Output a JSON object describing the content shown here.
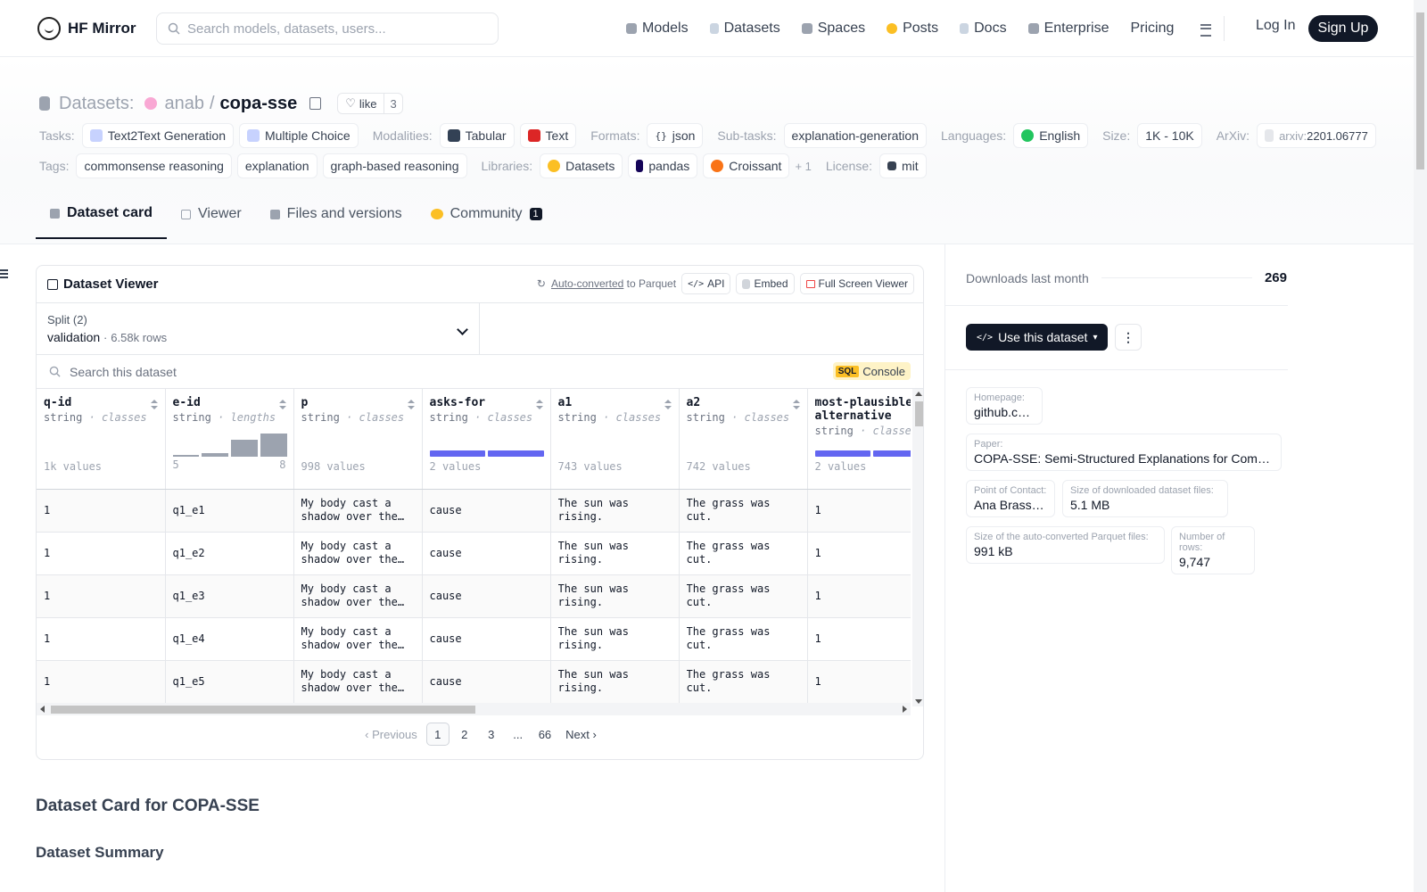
{
  "nav": {
    "brand": "HF Mirror",
    "search_placeholder": "Search models, datasets, users...",
    "links": [
      "Models",
      "Datasets",
      "Spaces",
      "Posts",
      "Docs",
      "Enterprise",
      "Pricing"
    ],
    "login": "Log In",
    "signup": "Sign Up"
  },
  "repo": {
    "section": "Datasets:",
    "owner": "anab",
    "sep": "/",
    "name": "copa-sse",
    "like_label": "like",
    "like_count": "3"
  },
  "tags": {
    "tasks_label": "Tasks:",
    "tasks": [
      "Text2Text Generation",
      "Multiple Choice"
    ],
    "modalities_label": "Modalities:",
    "modalities": [
      "Tabular",
      "Text"
    ],
    "formats_label": "Formats:",
    "formats": [
      "json"
    ],
    "subtasks_label": "Sub-tasks:",
    "subtasks": [
      "explanation-generation"
    ],
    "languages_label": "Languages:",
    "languages": [
      "English"
    ],
    "size_label": "Size:",
    "size": "1K - 10K",
    "arxiv_label": "ArXiv:",
    "arxiv_prefix": "arxiv:",
    "arxiv_id": "2201.06777",
    "tags_label": "Tags:",
    "tags": [
      "commonsense reasoning",
      "explanation",
      "graph-based reasoning"
    ],
    "libraries_label": "Libraries:",
    "libraries": [
      "Datasets",
      "pandas",
      "Croissant"
    ],
    "libraries_more": "+ 1",
    "license_label": "License:",
    "license": "mit"
  },
  "tabs": [
    {
      "label": "Dataset card"
    },
    {
      "label": "Viewer"
    },
    {
      "label": "Files and versions"
    },
    {
      "label": "Community",
      "badge": "1"
    }
  ],
  "viewer": {
    "title": "Dataset Viewer",
    "autoconv": "Auto-converted",
    "autoconv_tail": " to Parquet",
    "api": "API",
    "embed": "Embed",
    "fullscreen": "Full Screen Viewer",
    "split_label": "Split (2)",
    "split_value": "validation",
    "split_dot": "·",
    "split_rows": "6.58k rows",
    "search_placeholder": "Search this dataset",
    "sql_tag": "SQL",
    "sql_label": "Console",
    "columns": [
      {
        "name": "q-id",
        "type": "string",
        "kind": "classes",
        "values": "1k values"
      },
      {
        "name": "e-id",
        "type": "string",
        "kind": "lengths",
        "hist_min": "5",
        "hist_max": "8",
        "hist": [
          0.05,
          0.15,
          0.7,
          1.0
        ]
      },
      {
        "name": "p",
        "type": "string",
        "kind": "classes",
        "values": "998 values"
      },
      {
        "name": "asks-for",
        "type": "string",
        "kind": "classes",
        "values": "2 values"
      },
      {
        "name": "a1",
        "type": "string",
        "kind": "classes",
        "values": "743 values"
      },
      {
        "name": "a2",
        "type": "string",
        "kind": "classes",
        "values": "742 values"
      },
      {
        "name": "most-plausible-alternative",
        "type": "string",
        "kind": "classes",
        "values": "2 values"
      }
    ],
    "type_sep": " · ",
    "rows": [
      [
        "1",
        "q1_e1",
        "My body cast a shadow over the grass.",
        "cause",
        "The sun was rising.",
        "The grass was cut.",
        "1"
      ],
      [
        "1",
        "q1_e2",
        "My body cast a shadow over the grass.",
        "cause",
        "The sun was rising.",
        "The grass was cut.",
        "1"
      ],
      [
        "1",
        "q1_e3",
        "My body cast a shadow over the grass.",
        "cause",
        "The sun was rising.",
        "The grass was cut.",
        "1"
      ],
      [
        "1",
        "q1_e4",
        "My body cast a shadow over the grass.",
        "cause",
        "The sun was rising.",
        "The grass was cut.",
        "1"
      ],
      [
        "1",
        "q1_e5",
        "My body cast a shadow over the grass.",
        "cause",
        "The sun was rising.",
        "The grass was cut.",
        "1"
      ]
    ],
    "pager": {
      "prev": "Previous",
      "pages": [
        "1",
        "2",
        "3",
        "...",
        "66"
      ],
      "next": "Next"
    }
  },
  "card": {
    "h1": "Dataset Card for COPA-SSE",
    "h2": "Dataset Summary"
  },
  "side": {
    "downloads_label": "Downloads last month",
    "downloads": "269",
    "use_button": "Use this dataset",
    "meta": [
      {
        "k": "Homepage:",
        "v": "github.com"
      },
      {
        "k": "Paper:",
        "v": "COPA-SSE: Semi-Structured Explanations for Commonsense Reasoning"
      },
      {
        "k": "Point of Contact:",
        "v": "Ana Brassard"
      },
      {
        "k": "Size of downloaded dataset files:",
        "v": "5.1 MB"
      },
      {
        "k": "Size of the auto-converted Parquet files:",
        "v": "991 kB"
      },
      {
        "k": "Number of rows:",
        "v": "9,747"
      }
    ]
  }
}
